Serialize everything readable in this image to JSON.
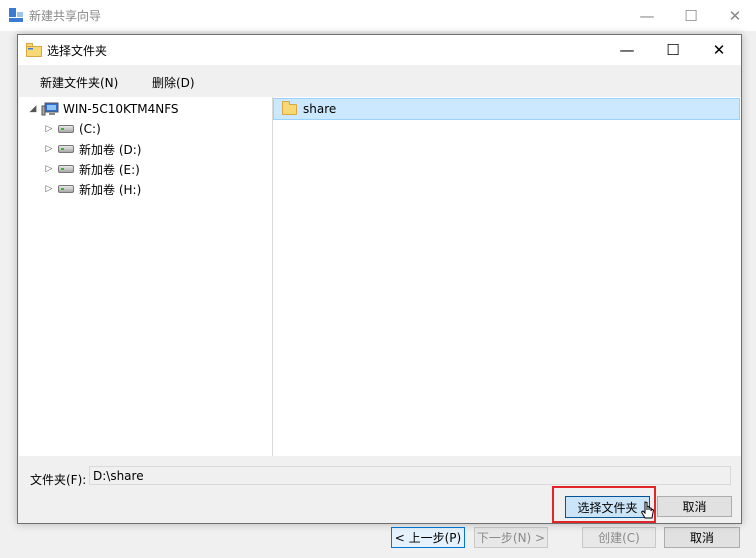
{
  "wizard": {
    "title": "新建共享向导",
    "controls": {
      "minimize": "—",
      "maximize": "☐",
      "close": "✕"
    },
    "buttons": {
      "prev": "< 上一步(P)",
      "next": "下一步(N) >",
      "create": "创建(C)",
      "cancel": "取消"
    }
  },
  "dialog": {
    "title": "选择文件夹",
    "controls": {
      "minimize": "—",
      "maximize": "☐",
      "close": "✕"
    },
    "menu": {
      "new_folder": "新建文件夹(N)",
      "delete": "删除(D)"
    },
    "tree": {
      "computer": "WIN-5C10KTM4NFS",
      "drives": [
        {
          "label": "(C:)"
        },
        {
          "label": "新加卷 (D:)"
        },
        {
          "label": "新加卷 (E:)"
        },
        {
          "label": "新加卷 (H:)"
        }
      ]
    },
    "list": {
      "items": [
        {
          "name": "share",
          "icon": "folder-icon",
          "selected": true
        }
      ]
    },
    "folder": {
      "label": "文件夹(F):",
      "value": "D:\\share"
    },
    "buttons": {
      "select": "选择文件夹",
      "cancel": "取消"
    }
  },
  "colors": {
    "selection": "#cce8ff",
    "highlight": "#e0252b",
    "accent": "#0078d7"
  }
}
